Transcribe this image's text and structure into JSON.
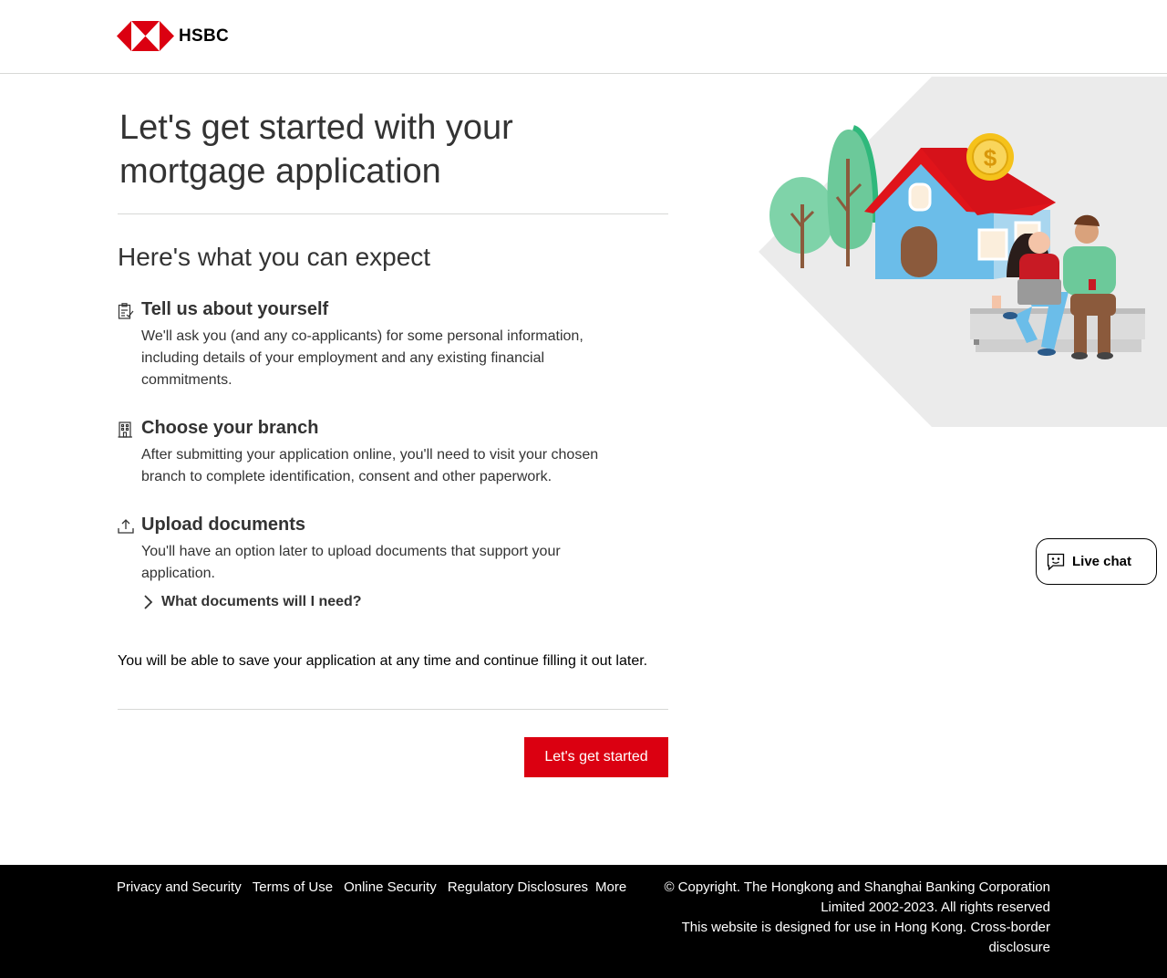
{
  "header": {
    "brand": "HSBC"
  },
  "main": {
    "title": "Let's get started with your mortgage application",
    "subtitle": "Here's what you can expect",
    "steps": [
      {
        "icon": "clipboard-check-icon",
        "title": "Tell us about yourself",
        "desc": "We'll ask you (and any co-applicants) for some personal information, including details of your employment and any existing financial commitments."
      },
      {
        "icon": "building-icon",
        "title": "Choose your branch",
        "desc": "After submitting your application online, you'll need to visit your chosen branch to complete identification, consent and other paperwork."
      },
      {
        "icon": "upload-icon",
        "title": "Upload documents",
        "desc": "You'll have an option later to upload documents that support your application."
      }
    ],
    "expander_label": "What documents will I need?",
    "save_note": "You will be able to save your application at any time and continue filling it out later.",
    "cta_label": "Let's get started"
  },
  "live_chat": {
    "label": "Live chat"
  },
  "footer": {
    "links": [
      "Privacy and Security",
      "Terms of Use",
      "Online Security",
      "Regulatory Disclosures",
      "More"
    ],
    "copyright": "© Copyright. The Hongkong and Shanghai Banking Corporation Limited 2002-2023. All rights reserved",
    "disclosure": "This website is designed for use in Hong Kong. Cross-border disclosure"
  },
  "colors": {
    "brand_red": "#db0011",
    "footer_bg": "#000000",
    "divider": "#d7d8d6"
  }
}
